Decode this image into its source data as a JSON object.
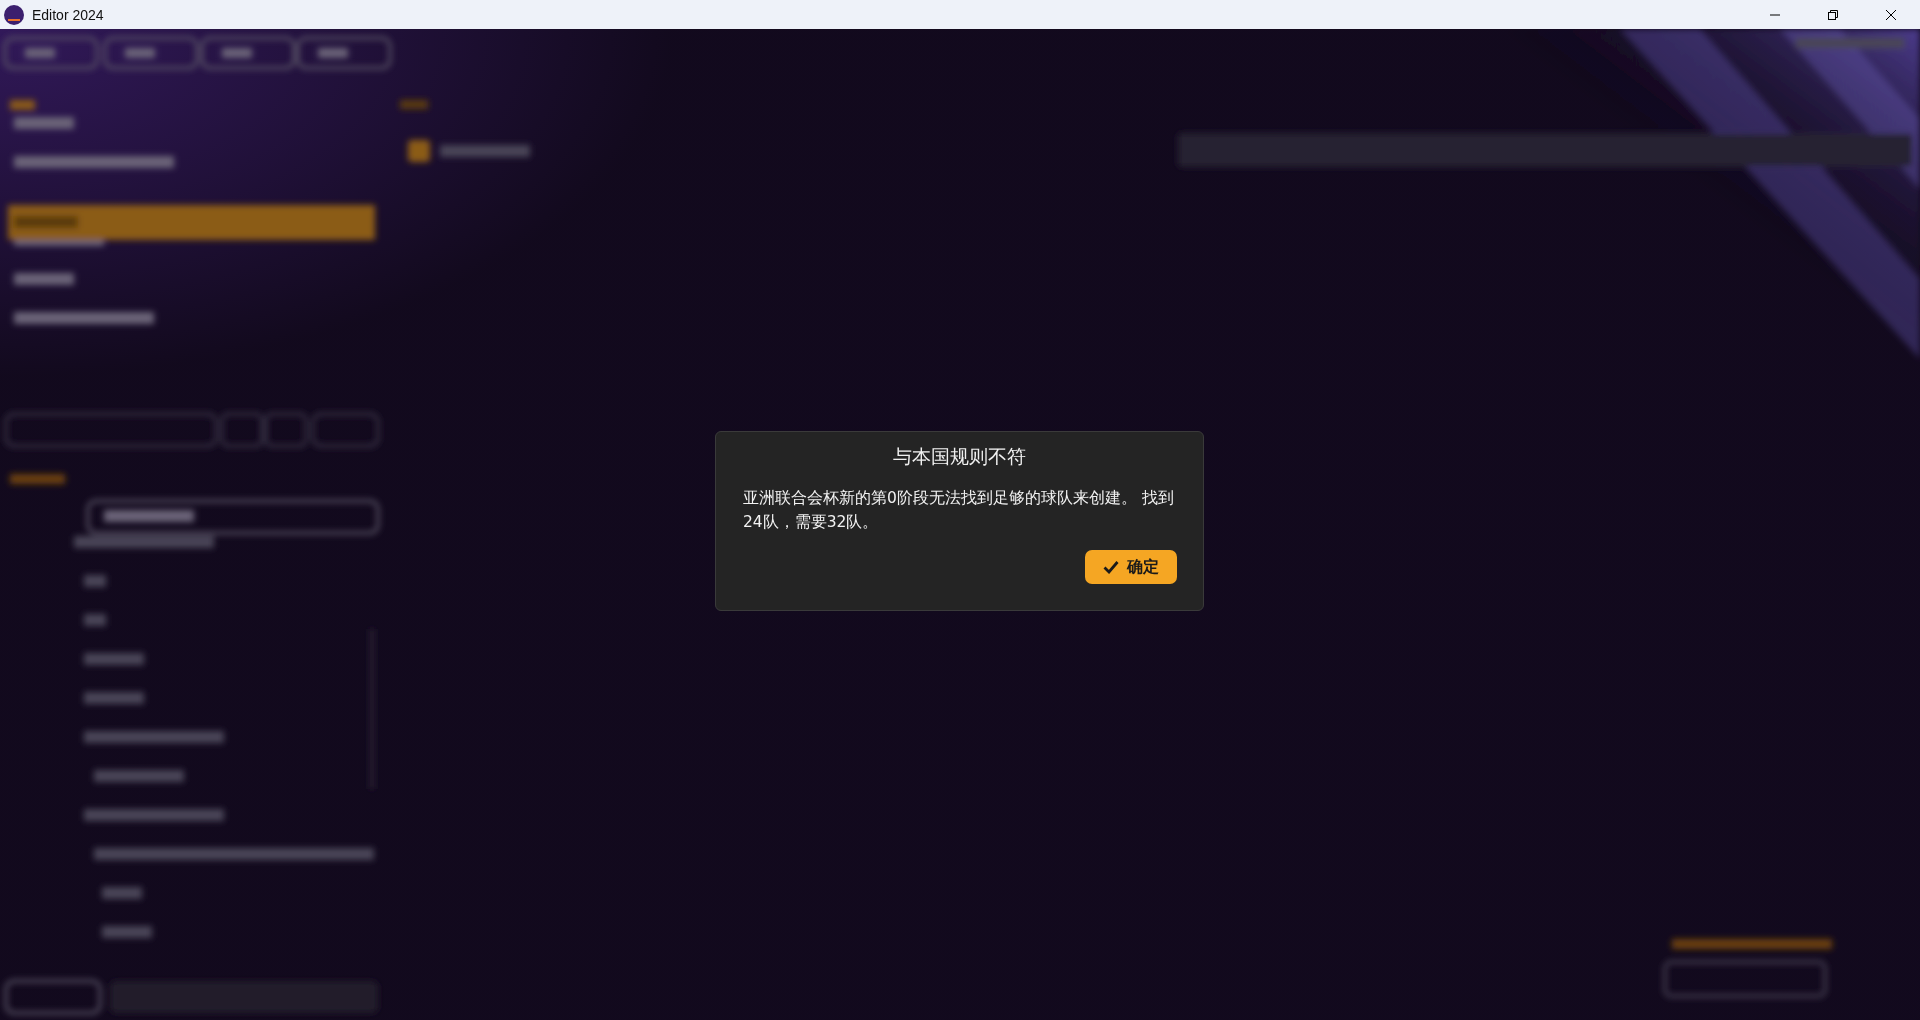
{
  "window": {
    "title": "Editor 2024"
  },
  "dialog": {
    "title": "与本国规则不符",
    "message": "亚洲联合会杯新的第0阶段无法找到足够的球队来创建。 找到24队，需要32队。",
    "button": "确定"
  }
}
